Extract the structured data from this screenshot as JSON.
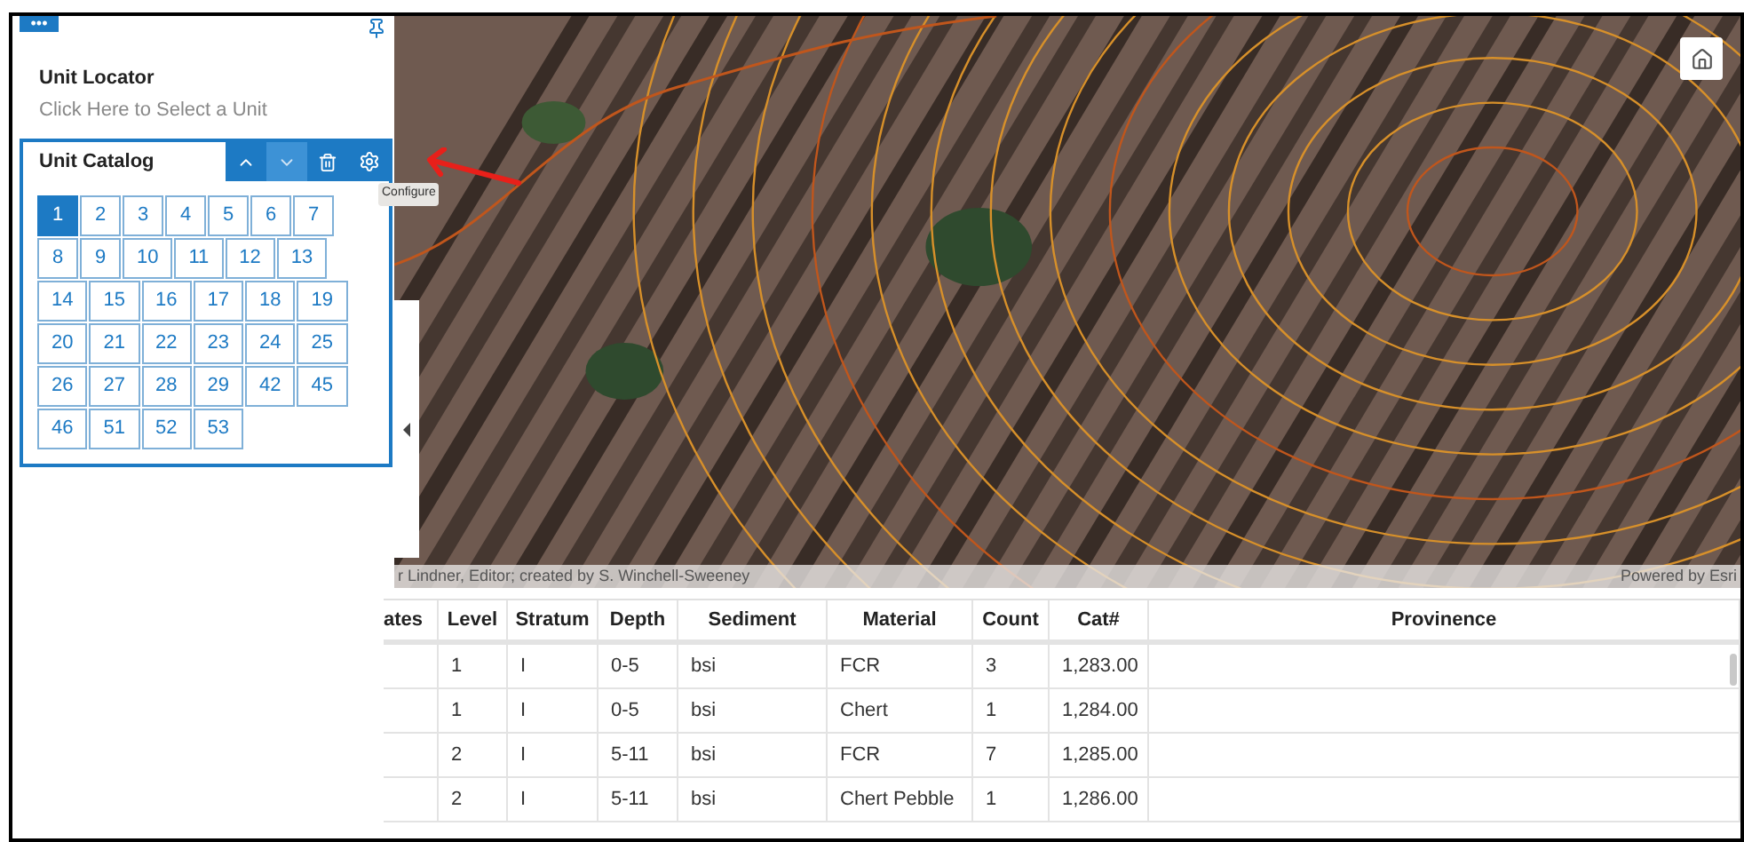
{
  "panel": {
    "menu_button": "•••",
    "locator": {
      "title": "Unit Locator",
      "hint": "Click Here to Select a Unit"
    },
    "catalog": {
      "title": "Unit Catalog",
      "units": [
        {
          "label": "1",
          "selected": true
        },
        {
          "label": "2",
          "selected": false
        },
        {
          "label": "3",
          "selected": false
        },
        {
          "label": "4",
          "selected": false
        },
        {
          "label": "5",
          "selected": false
        },
        {
          "label": "6",
          "selected": false
        },
        {
          "label": "7",
          "selected": false
        },
        {
          "label": "8",
          "selected": false
        },
        {
          "label": "9",
          "selected": false
        },
        {
          "label": "10",
          "selected": false
        },
        {
          "label": "11",
          "selected": false
        },
        {
          "label": "12",
          "selected": false
        },
        {
          "label": "13",
          "selected": false
        },
        {
          "label": "14",
          "selected": false
        },
        {
          "label": "15",
          "selected": false
        },
        {
          "label": "16",
          "selected": false
        },
        {
          "label": "17",
          "selected": false
        },
        {
          "label": "18",
          "selected": false
        },
        {
          "label": "19",
          "selected": false
        },
        {
          "label": "20",
          "selected": false
        },
        {
          "label": "21",
          "selected": false
        },
        {
          "label": "22",
          "selected": false
        },
        {
          "label": "23",
          "selected": false
        },
        {
          "label": "24",
          "selected": false
        },
        {
          "label": "25",
          "selected": false
        },
        {
          "label": "26",
          "selected": false
        },
        {
          "label": "27",
          "selected": false
        },
        {
          "label": "28",
          "selected": false
        },
        {
          "label": "29",
          "selected": false
        },
        {
          "label": "42",
          "selected": false
        },
        {
          "label": "45",
          "selected": false
        },
        {
          "label": "46",
          "selected": false
        },
        {
          "label": "51",
          "selected": false
        },
        {
          "label": "52",
          "selected": false
        },
        {
          "label": "53",
          "selected": false
        }
      ]
    },
    "tooltip": "Configure"
  },
  "map": {
    "attribution": "r Lindner, Editor; created by S. Winchell-Sweeney",
    "powered_by": "Powered by Esri"
  },
  "table": {
    "columns": [
      "ates",
      "Level",
      "Stratum",
      "Depth",
      "Sediment",
      "Material",
      "Count",
      "Cat#",
      "Provinence"
    ],
    "rows": [
      [
        "",
        "1",
        "I",
        "0-5",
        "bsi",
        "FCR",
        "3",
        "1,283.00",
        ""
      ],
      [
        "",
        "1",
        "I",
        "0-5",
        "bsi",
        "Chert",
        "1",
        "1,284.00",
        ""
      ],
      [
        "",
        "2",
        "I",
        "5-11",
        "bsi",
        "FCR",
        "7",
        "1,285.00",
        ""
      ],
      [
        "",
        "2",
        "I",
        "5-11",
        "bsi",
        "Chert Pebble",
        "1",
        "1,286.00",
        ""
      ]
    ]
  }
}
